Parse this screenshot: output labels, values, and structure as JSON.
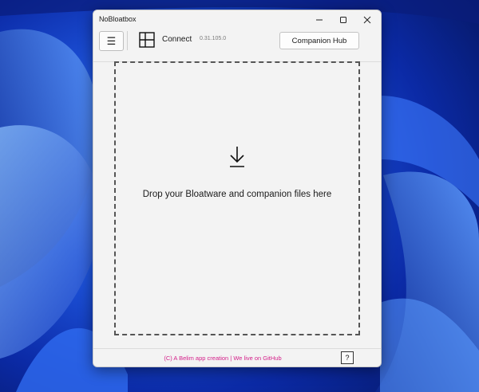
{
  "window": {
    "title": "NoBloatbox",
    "controls": {
      "minimize_icon": "minimize-icon",
      "maximize_icon": "maximize-icon",
      "close_icon": "close-icon"
    }
  },
  "toolbar": {
    "menu_icon": "hamburger-menu-icon",
    "menu_label": "☰",
    "connect_icon": "window-grid-icon",
    "connect_label": "Connect",
    "version": "0.31.105.0",
    "companion_hub_label": "Companion Hub"
  },
  "main": {
    "drop_icon": "download-arrow-icon",
    "drop_text": "Drop your Bloatware and companion files here"
  },
  "footer": {
    "credits_text": "(C) A Belim app creation | We live on GitHub",
    "help_label": "?"
  },
  "colors": {
    "accent_link": "#d4208a",
    "window_bg": "#f3f3f3",
    "wallpaper": "#0a1f8c"
  }
}
